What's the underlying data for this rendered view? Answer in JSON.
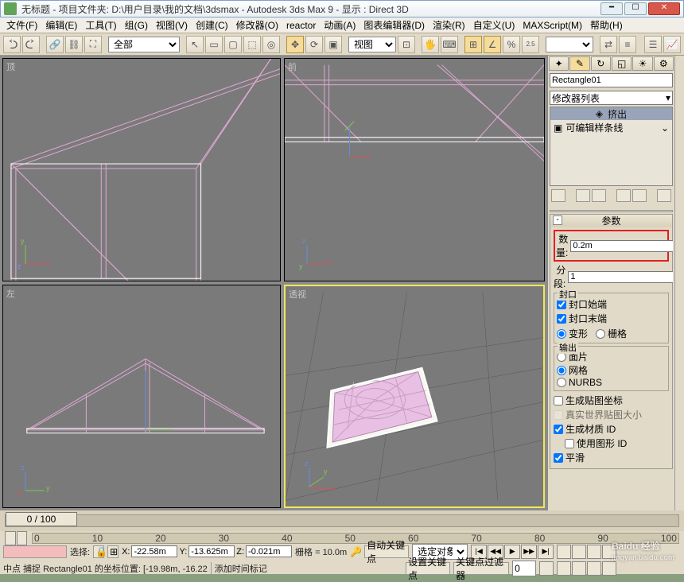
{
  "title": "无标题 - 项目文件夹: D:\\用户目录\\我的文档\\3dsmax    - Autodesk 3ds Max 9    - 显示 : Direct 3D",
  "menu": [
    "文件(F)",
    "编辑(E)",
    "工具(T)",
    "组(G)",
    "视图(V)",
    "创建(C)",
    "修改器(O)",
    "reactor",
    "动画(A)",
    "图表编辑器(D)",
    "渲染(R)",
    "自定义(U)",
    "MAXScript(M)",
    "帮助(H)"
  ],
  "toolbar": {
    "sel_scope": "全部",
    "named_set": "",
    "ref_dd": "视图",
    "snap_angle": "2.5"
  },
  "viewports": {
    "tl": "顶",
    "tr": "前",
    "bl": "左",
    "br": "透视"
  },
  "panel": {
    "cmd_tabs": [
      "✦",
      "✎",
      "↻",
      "◱",
      "☀",
      "⚙"
    ],
    "obj_name": "Rectangle01",
    "mod_dd": "修改器列表",
    "mod_header": "挤出",
    "mod_items": [
      "可编辑样条线"
    ],
    "rollup_param": "参数",
    "amount_lbl": "数量:",
    "amount_val": "0.2m",
    "seg_lbl": "分段:",
    "seg_val": "1",
    "cap_title": "封口",
    "cap_start": "封口始端",
    "cap_end": "封口末端",
    "cap_morph": "变形",
    "cap_grid": "栅格",
    "output_title": "输出",
    "out_patch": "面片",
    "out_mesh": "网格",
    "out_nurbs": "NURBS",
    "gen_coords": "生成贴图坐标",
    "real_world": "真实世界贴图大小",
    "gen_matid": "生成材质 ID",
    "use_shapeid": "使用图形 ID",
    "smooth": "平滑"
  },
  "time": {
    "frame_range": "0  /  100",
    "ticks": [
      "0",
      "10",
      "20",
      "30",
      "40",
      "50",
      "60",
      "70",
      "80",
      "90",
      "100"
    ]
  },
  "status": {
    "select_lbl": "选择:",
    "x_lbl": "X:",
    "x": "-22.58m",
    "y_lbl": "Y:",
    "y": "-13.625m",
    "z_lbl": "Z:",
    "z": "-0.021m",
    "grid_lbl": "栅格 = 10.0m",
    "autokey": "自动关键点",
    "selset": "选定对象",
    "setkey": "设置关键点",
    "keyfilter": "关键点过滤器",
    "msg1": "中点 捕捉 Rectangle01 的坐标位置: [-19.98m, -16.22",
    "msg2": "添加时间标记"
  },
  "watermark": {
    "brand": "Baidu 经验",
    "url": "jingyan.baidu.com"
  }
}
